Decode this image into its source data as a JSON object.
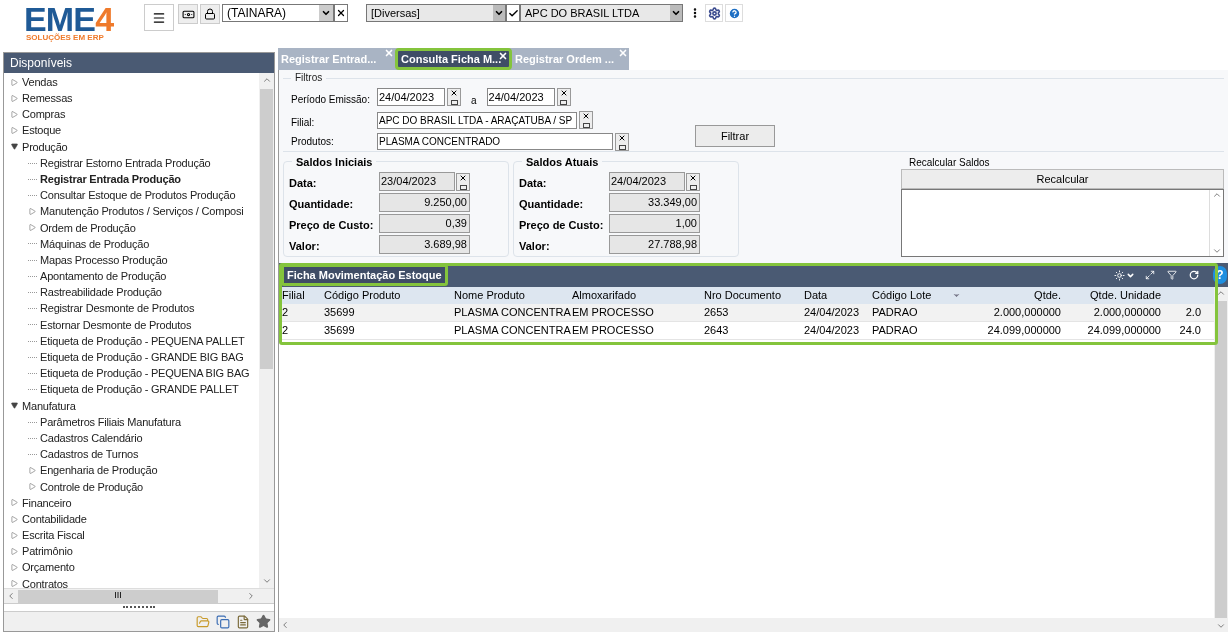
{
  "logo": {
    "brand": "EME",
    "digit": "4",
    "tagline": "SOLUÇÕES EM ERP"
  },
  "toolbar": {
    "user": "(TAINARA)",
    "group": "[Diversas]",
    "company": "APC DO BRASIL LTDA"
  },
  "sidebar": {
    "title": "Disponíveis",
    "tree": [
      {
        "label": "Vendas",
        "expanded": false,
        "selected": false
      },
      {
        "label": "Remessas",
        "expanded": false,
        "selected": false
      },
      {
        "label": "Compras",
        "expanded": false,
        "selected": false
      },
      {
        "label": "Estoque",
        "expanded": false,
        "selected": false
      },
      {
        "label": "Produção",
        "expanded": true,
        "selected": false,
        "children": [
          {
            "label": "Registrar Estorno Entrada Produção",
            "selected": false
          },
          {
            "label": "Registrar Entrada Produção",
            "selected": true
          },
          {
            "label": "Consultar Estoque de Produtos Produção",
            "selected": false
          },
          {
            "label": "Manutenção Produtos / Serviços / Composi",
            "expanded": false,
            "selected": false
          },
          {
            "label": "Ordem de Produção",
            "expanded": false,
            "selected": false
          },
          {
            "label": "Máquinas de Produção",
            "selected": false
          },
          {
            "label": "Mapas Processo Produção",
            "selected": false
          },
          {
            "label": "Apontamento de Produção",
            "selected": false
          },
          {
            "label": "Rastreabilidade Produção",
            "selected": false
          },
          {
            "label": "Registrar Desmonte de Produtos",
            "selected": false
          },
          {
            "label": "Estornar Desmonte de Produtos",
            "selected": false
          },
          {
            "label": "Etiqueta de Produção - PEQUENA PALLET",
            "selected": false
          },
          {
            "label": "Etiqueta de Produção - GRANDE BIG BAG",
            "selected": false
          },
          {
            "label": "Etiqueta de Produção - PEQUENA BIG BAG",
            "selected": false
          },
          {
            "label": "Etiqueta de Produção - GRANDE PALLET",
            "selected": false
          }
        ]
      },
      {
        "label": "Manufatura",
        "expanded": true,
        "selected": false,
        "children": [
          {
            "label": "Parâmetros Filiais Manufatura",
            "selected": false
          },
          {
            "label": "Cadastros Calendário",
            "selected": false
          },
          {
            "label": "Cadastros de Turnos",
            "selected": false
          },
          {
            "label": "Engenharia de Produção",
            "expanded": false,
            "selected": false
          },
          {
            "label": "Controle de Produção",
            "expanded": false,
            "selected": false
          }
        ]
      },
      {
        "label": "Financeiro",
        "expanded": false,
        "selected": false
      },
      {
        "label": "Contabilidade",
        "expanded": false,
        "selected": false
      },
      {
        "label": "Escrita Fiscal",
        "expanded": false,
        "selected": false
      },
      {
        "label": "Patrimônio",
        "expanded": false,
        "selected": false
      },
      {
        "label": "Orçamento",
        "expanded": false,
        "selected": false
      },
      {
        "label": "Contratos",
        "expanded": false,
        "selected": false
      }
    ],
    "scroll_grip": "III"
  },
  "tabs": [
    {
      "label": "Registrar Entrad...",
      "selected": false
    },
    {
      "label": "Consulta Ficha M...",
      "selected": true
    },
    {
      "label": "Registrar Ordem ...",
      "selected": false
    }
  ],
  "filters": {
    "title": "Filtros",
    "period_label": "Período Emissão:",
    "date_from": "24/04/2023",
    "between": "a",
    "date_to": "24/04/2023",
    "branch_label": "Filial:",
    "branch": "APC DO BRASIL LTDA - ARAÇATUBA / SP",
    "products_label": "Produtos:",
    "products": "PLASMA CONCENTRADO",
    "filter_button": "Filtrar"
  },
  "balances": [
    {
      "title": "Saldos Iniciais",
      "fields": [
        {
          "label": "Data:",
          "value": "23/04/2023",
          "kind": "date"
        },
        {
          "label": "Quantidade:",
          "value": "9.250,00",
          "kind": "number"
        },
        {
          "label": "Preço de Custo:",
          "value": "0,39",
          "kind": "number"
        },
        {
          "label": "Valor:",
          "value": "3.689,98",
          "kind": "number"
        }
      ]
    },
    {
      "title": "Saldos Atuais",
      "fields": [
        {
          "label": "Data:",
          "value": "24/04/2023",
          "kind": "date"
        },
        {
          "label": "Quantidade:",
          "value": "33.349,00",
          "kind": "number"
        },
        {
          "label": "Preço de Custo:",
          "value": "1,00",
          "kind": "number"
        },
        {
          "label": "Valor:",
          "value": "27.788,98",
          "kind": "number"
        }
      ]
    }
  ],
  "recalc": {
    "title": "Recalcular Saldos",
    "button": "Recalcular"
  },
  "grid": {
    "title": "Ficha Movimentação Estoque",
    "help": "?",
    "columns": [
      {
        "label": "Filial",
        "sorted": false
      },
      {
        "label": "Código Produto",
        "sorted": false
      },
      {
        "label": "Nome Produto",
        "sorted": false
      },
      {
        "label": "Almoxarifado",
        "sorted": false
      },
      {
        "label": "Nro Documento",
        "sorted": false
      },
      {
        "label": "Data",
        "sorted": false
      },
      {
        "label": "Código Lote",
        "sorted": true
      },
      {
        "label": "Qtde.",
        "sorted": false
      },
      {
        "label": "Qtde. Unidade",
        "sorted": false
      }
    ],
    "rows": [
      [
        "2",
        "35699",
        "PLASMA CONCENTRA",
        "EM PROCESSO",
        "2653",
        "24/04/2023",
        "PADRAO",
        "2.000,000000",
        "2.000,000000",
        "2.0"
      ],
      [
        "2",
        "35699",
        "PLASMA CONCENTRA",
        "EM PROCESSO",
        "2643",
        "24/04/2023",
        "PADRAO",
        "24.099,000000",
        "24.099,000000",
        "24.0"
      ]
    ]
  }
}
